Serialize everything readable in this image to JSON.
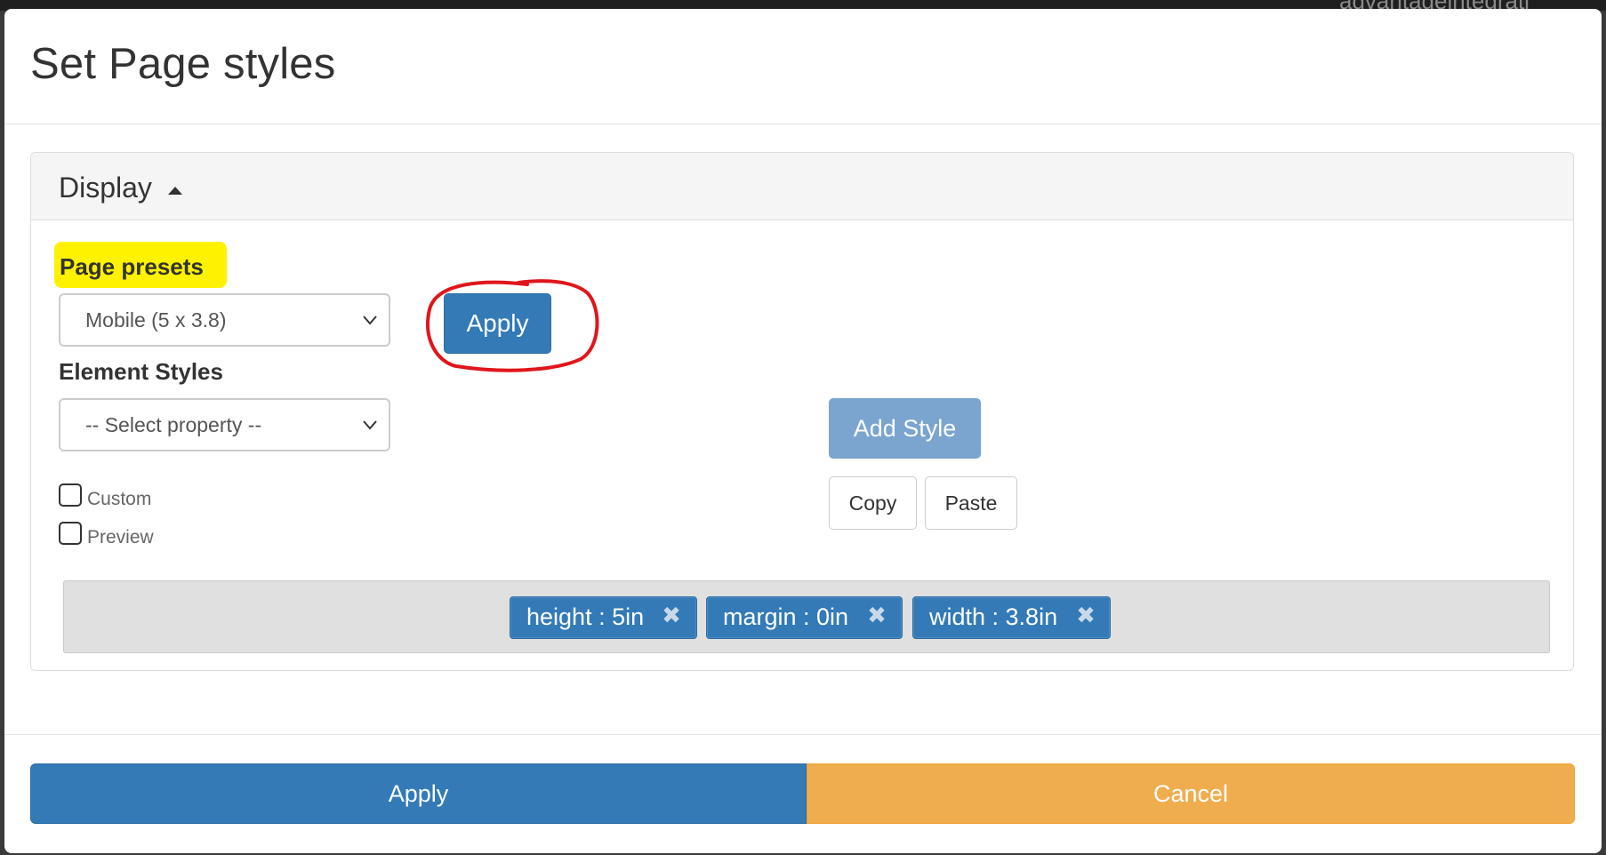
{
  "background": {
    "partial_text": "advantageintegrati"
  },
  "modal": {
    "title": "Set Page styles",
    "panel": {
      "heading": "Display",
      "page_presets": {
        "label": "Page presets",
        "selected": "Mobile (5 x 3.8)",
        "apply_label": "Apply"
      },
      "element_styles": {
        "label": "Element Styles",
        "selected": "-- Select property --"
      },
      "add_style_label": "Add Style",
      "copy_label": "Copy",
      "paste_label": "Paste",
      "checkboxes": [
        {
          "label": "Custom",
          "checked": false
        },
        {
          "label": "Preview",
          "checked": false
        }
      ],
      "style_chips": [
        {
          "label": "height : 5in"
        },
        {
          "label": "margin : 0in"
        },
        {
          "label": "width : 3.8in"
        }
      ],
      "chip_remove_glyph": "✖"
    },
    "footer": {
      "apply_label": "Apply",
      "cancel_label": "Cancel"
    }
  },
  "colors": {
    "primary": "#337ab7",
    "warning": "#f0ad4e",
    "highlight": "#fff200",
    "annotation": "#e0161b"
  }
}
